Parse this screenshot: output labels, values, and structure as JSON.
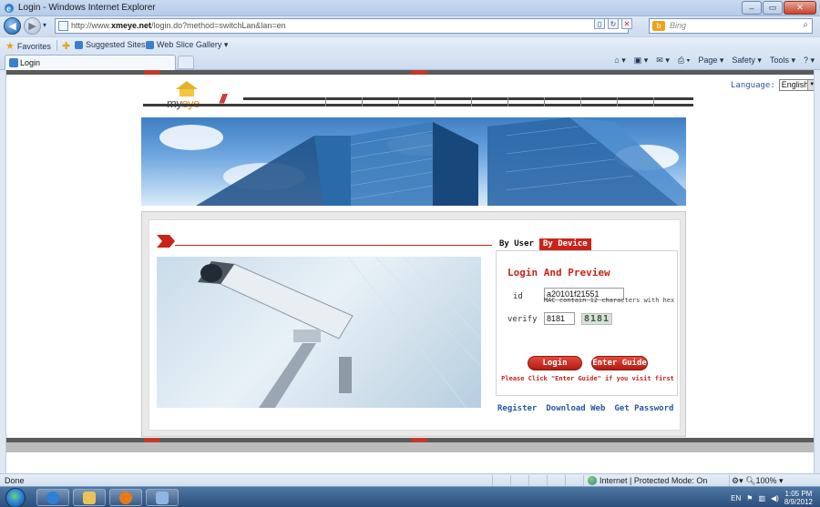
{
  "window": {
    "title": "Login - Windows Internet Explorer"
  },
  "address": {
    "url_prefix": "http://www.",
    "url_host": "xmeye.net",
    "url_suffix": "/login.do?method=switchLan&lan=en",
    "search_placeholder": "Bing"
  },
  "favorites": {
    "label": "Favorites",
    "suggested": "Suggested Sites ▾",
    "slice": "Web Slice Gallery ▾"
  },
  "tabs": {
    "active_label": "Login"
  },
  "command_bar": [
    "Page ▾",
    "Safety ▾",
    "Tools ▾"
  ],
  "page": {
    "language_label": "Language:",
    "language_value": "English",
    "logo_text_a": "my",
    "logo_text_b": "eye",
    "tab_user": "By User",
    "tab_device": "By Device",
    "form_title": "Login And Preview",
    "id_label": "id",
    "id_value": "a20101f21551",
    "id_hint": "MAC contain 12 characters with hex",
    "verify_label": "verify",
    "verify_value": "8181",
    "captcha": "8181",
    "login_button": "Login",
    "guide_button": "Enter Guide",
    "notice": "Please Click \"Enter Guide\" if you visit first",
    "links": [
      "Register",
      "Download Web",
      "Get Password"
    ]
  },
  "status": {
    "left": "Done",
    "zone": "Internet | Protected Mode: On",
    "zoom": "100%"
  },
  "taskbar": {
    "lang": "EN",
    "time": "1:05 PM",
    "date": "8/9/2012"
  }
}
